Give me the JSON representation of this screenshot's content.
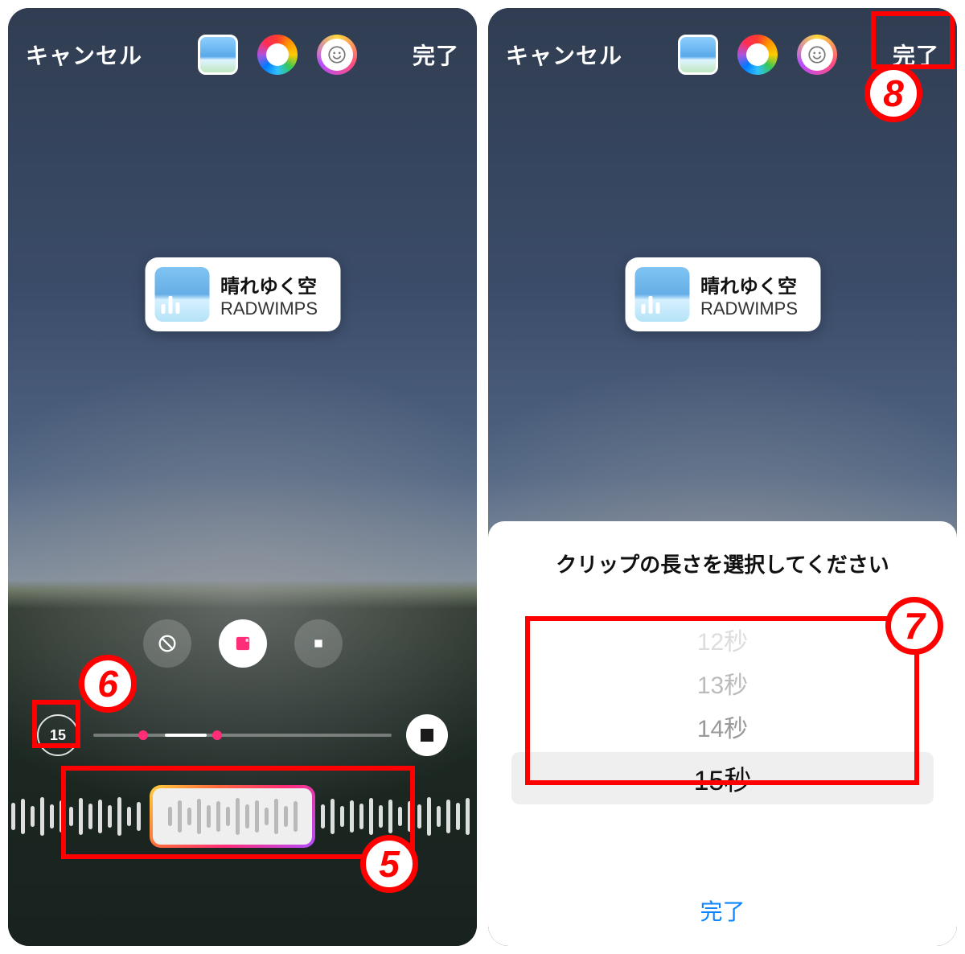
{
  "common": {
    "cancel": "キャンセル",
    "done": "完了",
    "music": {
      "title": "晴れゆく空",
      "artist": "RADWIMPS"
    }
  },
  "left": {
    "duration": "15",
    "annotations": {
      "n5": "5",
      "n6": "6"
    }
  },
  "right": {
    "sheet_title": "クリップの長さを選択してください",
    "picker": {
      "opt12": "12秒",
      "opt13": "13秒",
      "opt14": "14秒",
      "selected": "15秒"
    },
    "sheet_done": "完了",
    "annotations": {
      "n7": "7",
      "n8": "8"
    }
  }
}
